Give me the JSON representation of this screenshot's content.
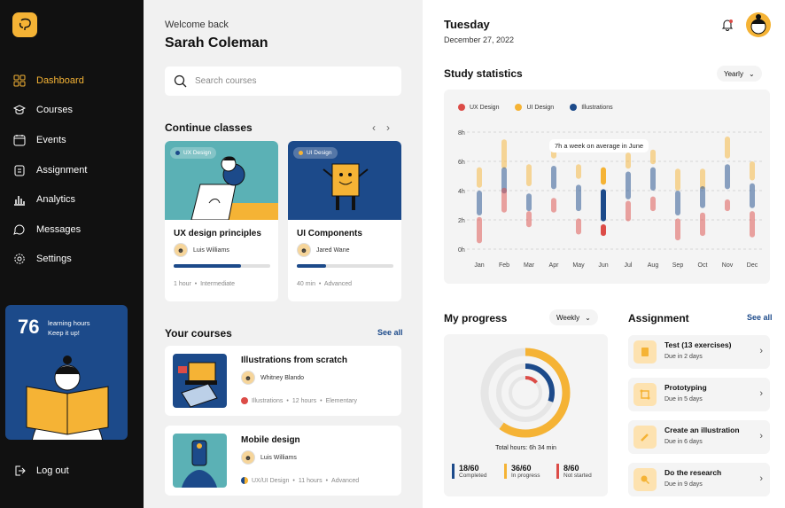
{
  "sidebar": {
    "items": [
      {
        "label": "Dashboard",
        "icon": "grid-icon",
        "active": true
      },
      {
        "label": "Courses",
        "icon": "courses-icon"
      },
      {
        "label": "Events",
        "icon": "calendar-icon"
      },
      {
        "label": "Assignment",
        "icon": "assignment-icon"
      },
      {
        "label": "Analytics",
        "icon": "chart-icon"
      },
      {
        "label": "Messages",
        "icon": "messages-icon"
      },
      {
        "label": "Settings",
        "icon": "settings-icon"
      }
    ],
    "promo": {
      "number": "76",
      "line1": "learning hours",
      "line2": "Keep it up!"
    },
    "logout": "Log out"
  },
  "header": {
    "greeting": "Welcome back",
    "name": "Sarah Coleman"
  },
  "search": {
    "placeholder": "Search courses"
  },
  "continue": {
    "title": "Continue classes",
    "cards": [
      {
        "tag": "UX Design",
        "tag_color": "#1c4a8a",
        "title": "UX design principles",
        "author": "Luis Williams",
        "progress": 0.7,
        "duration": "1 hour",
        "level": "Intermediate"
      },
      {
        "tag": "UI Design",
        "tag_color": "#f5b335",
        "title": "UI Components",
        "author": "Jared Wane",
        "progress": 0.3,
        "duration": "40 min",
        "level": "Advanced"
      }
    ]
  },
  "your_courses": {
    "title": "Your courses",
    "see_all": "See all",
    "items": [
      {
        "title": "Illustrations from scratch",
        "author": "Whitney Blando",
        "category": "Illustrations",
        "hours": "12 hours",
        "level": "Elementary"
      },
      {
        "title": "Mobile design",
        "author": "Luis Williams",
        "category": "UX/UI Design",
        "hours": "11 hours",
        "level": "Advanced"
      }
    ]
  },
  "top": {
    "day": "Tuesday",
    "date": "December 27, 2022"
  },
  "stats": {
    "title": "Study statistics",
    "period": "Yearly",
    "tooltip": "7h a week on average in June"
  },
  "chart_data": {
    "type": "bar",
    "series": [
      {
        "name": "UX Design",
        "color": "#dc4c47"
      },
      {
        "name": "UI Design",
        "color": "#f5b335"
      },
      {
        "name": "Illustrations",
        "color": "#1c4a8a"
      }
    ],
    "categories": [
      "Jan",
      "Feb",
      "Mar",
      "Apr",
      "May",
      "Jun",
      "Jul",
      "Aug",
      "Sep",
      "Oct",
      "Nov",
      "Dec"
    ],
    "yticks": [
      "0h",
      "2h",
      "4h",
      "6h",
      "8h"
    ],
    "ylim": [
      0,
      8
    ],
    "ranges": [
      {
        "ui": [
          4.2,
          5.6
        ],
        "ux": [
          0.4,
          2.2
        ],
        "il": [
          2.3,
          4.0
        ]
      },
      {
        "ui": [
          5.5,
          7.5
        ],
        "ux": [
          2.5,
          4.2
        ],
        "il": [
          3.8,
          5.6
        ]
      },
      {
        "ui": [
          4.3,
          5.8
        ],
        "ux": [
          1.5,
          2.6
        ],
        "il": [
          2.6,
          3.8
        ]
      },
      {
        "ui": [
          6.2,
          7.2
        ],
        "ux": [
          2.5,
          3.5
        ],
        "il": [
          4.1,
          5.7
        ]
      },
      {
        "ui": [
          4.8,
          5.8
        ],
        "ux": [
          1.0,
          2.1
        ],
        "il": [
          2.6,
          4.4
        ]
      },
      {
        "ui": [
          4.4,
          5.6
        ],
        "ux": [
          0.9,
          1.7
        ],
        "il": [
          1.9,
          4.1
        ]
      },
      {
        "ui": [
          5.5,
          6.6
        ],
        "ux": [
          1.9,
          3.3
        ],
        "il": [
          3.4,
          5.3
        ]
      },
      {
        "ui": [
          5.8,
          6.8
        ],
        "ux": [
          2.6,
          3.6
        ],
        "il": [
          4.0,
          5.6
        ]
      },
      {
        "ui": [
          4.0,
          5.5
        ],
        "ux": [
          0.6,
          2.1
        ],
        "il": [
          2.3,
          4.0
        ]
      },
      {
        "ui": [
          4.1,
          5.5
        ],
        "ux": [
          0.9,
          2.5
        ],
        "il": [
          2.8,
          4.3
        ]
      },
      {
        "ui": [
          6.2,
          7.7
        ],
        "ux": [
          2.6,
          3.4
        ],
        "il": [
          4.1,
          5.8
        ]
      },
      {
        "ui": [
          4.7,
          6.0
        ],
        "ux": [
          0.8,
          2.6
        ],
        "il": [
          2.8,
          4.5
        ]
      }
    ]
  },
  "progress": {
    "title": "My progress",
    "period": "Weekly",
    "total": "Total hours: 6h 34 min",
    "items": [
      {
        "value": "18/60",
        "label": "Completed",
        "color": "#1c4a8a"
      },
      {
        "value": "36/60",
        "label": "In progress",
        "color": "#f5b335"
      },
      {
        "value": "8/60",
        "label": "Not started",
        "color": "#dc4c47"
      }
    ]
  },
  "assignment": {
    "title": "Assignment",
    "see_all": "See all",
    "items": [
      {
        "title": "Test (13 exercises)",
        "due": "Due in 2 days",
        "icon": "document-icon"
      },
      {
        "title": "Prototyping",
        "due": "Due in 5 days",
        "icon": "frame-icon"
      },
      {
        "title": "Create an illustration",
        "due": "Due in 6 days",
        "icon": "brush-icon"
      },
      {
        "title": "Do the research",
        "due": "Due in 9 days",
        "icon": "magnifier-icon"
      }
    ]
  }
}
